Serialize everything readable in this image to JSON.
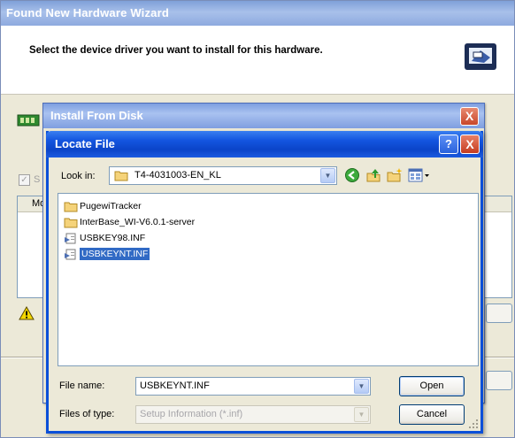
{
  "wizard": {
    "title": "Found New Hardware Wizard",
    "header_text": "Select the device driver you want to install for this hardware.",
    "checkbox_fragment": "S",
    "list_column_fragment": "Mo"
  },
  "install_from_disk": {
    "title": "Install From Disk",
    "close_glyph": "X"
  },
  "locate_file": {
    "title": "Locate File",
    "help_glyph": "?",
    "close_glyph": "X",
    "look_in": {
      "label": "Look in:",
      "value": "T4-4031003-EN_KL"
    },
    "toolbar": [
      "back-icon",
      "up-folder-icon",
      "new-folder-icon",
      "view-menu-icon"
    ],
    "files": [
      {
        "name": "PugewiTracker",
        "type": "folder",
        "selected": false
      },
      {
        "name": "InterBase_WI-V6.0.1-server",
        "type": "folder",
        "selected": false
      },
      {
        "name": "USBKEY98.INF",
        "type": "inf",
        "selected": false
      },
      {
        "name": "USBKEYNT.INF",
        "type": "inf",
        "selected": true
      }
    ],
    "file_name": {
      "label": "File name:",
      "value": "USBKEYNT.INF"
    },
    "file_type": {
      "label": "Files of type:",
      "value": "Setup Information (*.inf)"
    },
    "open_label": "Open",
    "cancel_label": "Cancel"
  }
}
